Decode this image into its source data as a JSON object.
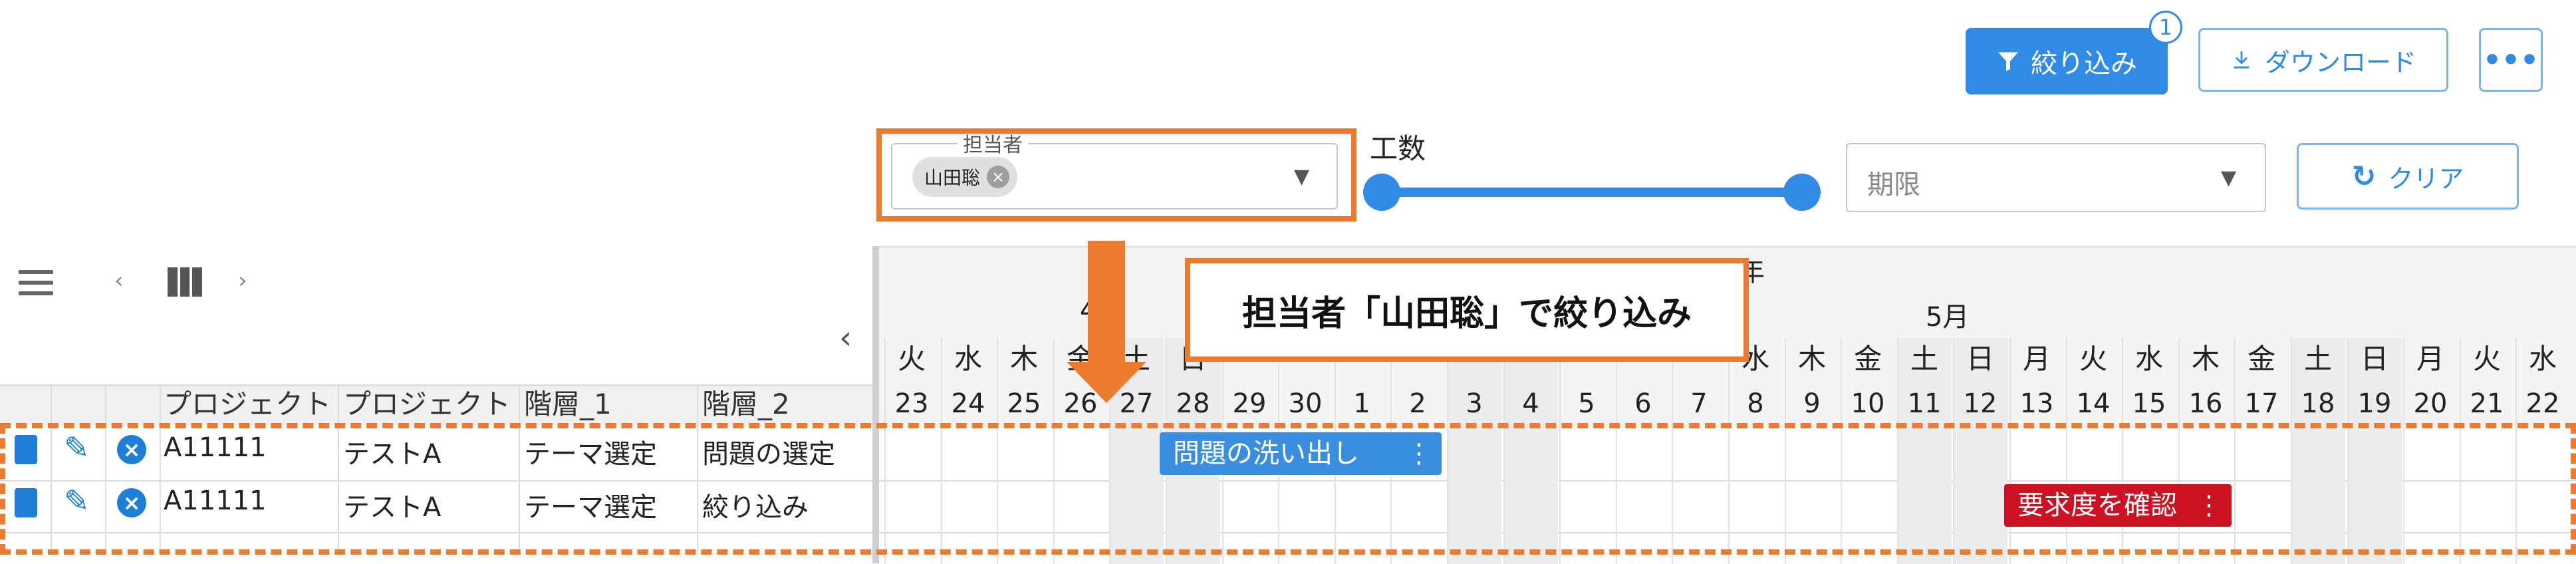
{
  "toolbar": {
    "filter_label": "絞り込み",
    "filter_badge": "1",
    "download_label": "ダウンロード",
    "more_label": "•••",
    "filter_icon": "funnel-icon",
    "download_icon": "download-icon"
  },
  "filters": {
    "assignee_legend": "担当者",
    "assignee_chip": "山田聡",
    "kosu_label": "工数",
    "deadline_placeholder": "期限",
    "clear_label": "クリア"
  },
  "grid": {
    "headers": [
      "プロジェクト",
      "プロジェクト",
      "階層_1",
      "階層_2"
    ],
    "rows": [
      {
        "code": "A11111",
        "project": "テストA",
        "level1": "テーマ選定",
        "level2": "問題の選定"
      },
      {
        "code": "A11111",
        "project": "テストA",
        "level1": "テーマ選定",
        "level2": "絞り込み"
      }
    ]
  },
  "gantt": {
    "year_label": "年",
    "month_prev": "4",
    "month_current": "5月",
    "days": [
      {
        "dow": "火",
        "num": "23"
      },
      {
        "dow": "水",
        "num": "24"
      },
      {
        "dow": "木",
        "num": "25"
      },
      {
        "dow": "金",
        "num": "26"
      },
      {
        "dow": "土",
        "num": "27"
      },
      {
        "dow": "日",
        "num": "28"
      },
      {
        "dow": "",
        "num": "29"
      },
      {
        "dow": "",
        "num": "30"
      },
      {
        "dow": "",
        "num": "1"
      },
      {
        "dow": "",
        "num": "2"
      },
      {
        "dow": "",
        "num": "3"
      },
      {
        "dow": "",
        "num": "4"
      },
      {
        "dow": "",
        "num": "5"
      },
      {
        "dow": "",
        "num": "6"
      },
      {
        "dow": "",
        "num": "7"
      },
      {
        "dow": "水",
        "num": "8"
      },
      {
        "dow": "木",
        "num": "9"
      },
      {
        "dow": "金",
        "num": "10"
      },
      {
        "dow": "土",
        "num": "11"
      },
      {
        "dow": "日",
        "num": "12"
      },
      {
        "dow": "月",
        "num": "13"
      },
      {
        "dow": "火",
        "num": "14"
      },
      {
        "dow": "水",
        "num": "15"
      },
      {
        "dow": "木",
        "num": "16"
      },
      {
        "dow": "金",
        "num": "17"
      },
      {
        "dow": "土",
        "num": "18"
      },
      {
        "dow": "日",
        "num": "19"
      },
      {
        "dow": "月",
        "num": "20"
      },
      {
        "dow": "火",
        "num": "21"
      },
      {
        "dow": "水",
        "num": "22"
      }
    ],
    "bars": [
      {
        "label": "問題の洗い出し",
        "color": "#3a8ee0"
      },
      {
        "label": "要求度を確認",
        "color": "#cc1122"
      }
    ]
  },
  "annotation": {
    "callout": "担当者「山田聡」で絞り込み",
    "accent": "#ec7a2f"
  }
}
